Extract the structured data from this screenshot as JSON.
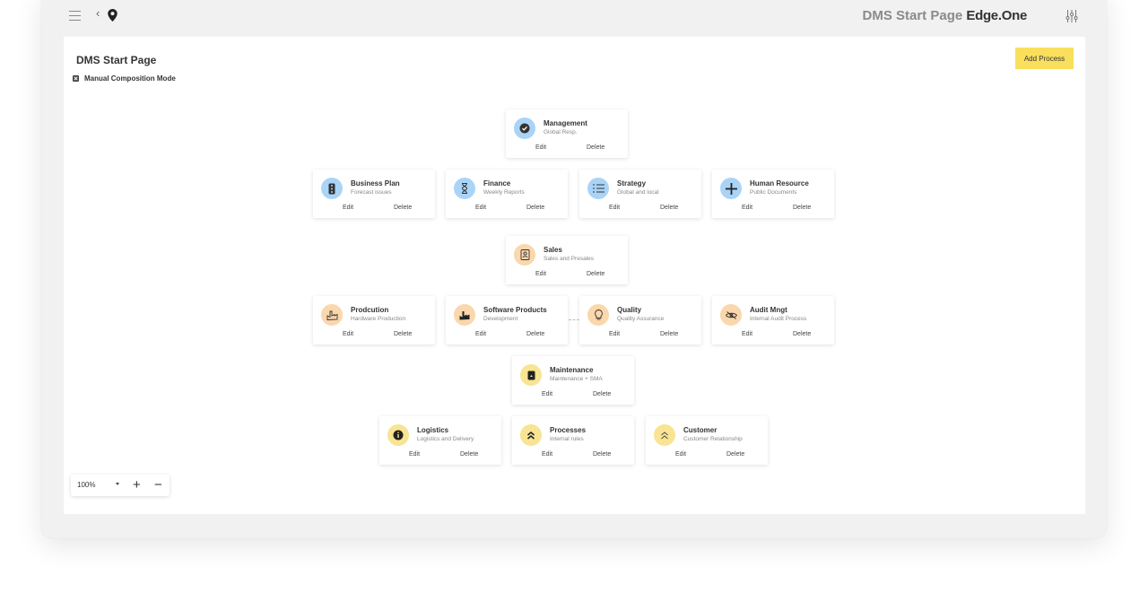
{
  "header": {
    "brand_muted": "DMS Start Page",
    "brand_strong": "Edge.One",
    "back_glyph": "‹"
  },
  "page": {
    "title": "DMS Start Page",
    "add_button": "Add Process",
    "manual_mode_label": "Manual Composition Mode",
    "manual_mode_checked": true
  },
  "actions": {
    "edit": "Edit",
    "delete": "Delete"
  },
  "colors": {
    "blue": "#a9d4f7",
    "orange": "#fad7ac",
    "yellow": "#f8e492",
    "accent": "#f9df5c"
  },
  "cards": [
    {
      "title": "Management",
      "subtitle": "Global Resp.",
      "icon": "check-circle-icon",
      "color": "blue"
    },
    {
      "title": "Business Plan",
      "subtitle": "Forecast issues",
      "icon": "traffic-light-icon",
      "color": "blue"
    },
    {
      "title": "Finance",
      "subtitle": "Weekly Reports",
      "icon": "hourglass-icon",
      "color": "blue"
    },
    {
      "title": "Strategy",
      "subtitle": "Global and local",
      "icon": "list-icon",
      "color": "blue"
    },
    {
      "title": "Human Resource",
      "subtitle": "Public Documents",
      "icon": "plus-icon",
      "color": "blue"
    },
    {
      "title": "Sales",
      "subtitle": "Sales and Presales",
      "icon": "contact-book-icon",
      "color": "orange"
    },
    {
      "title": "Prodcution",
      "subtitle": "Hardware Production",
      "icon": "factory-outline-icon",
      "color": "orange"
    },
    {
      "title": "Software Products",
      "subtitle": "Development",
      "icon": "factory-icon",
      "color": "orange"
    },
    {
      "title": "Quality",
      "subtitle": "Quality Assurance",
      "icon": "lightbulb-icon",
      "color": "orange"
    },
    {
      "title": "Audit Mngt",
      "subtitle": "Internal Audit Process",
      "icon": "eye-off-icon",
      "color": "orange"
    },
    {
      "title": "Maintenance",
      "subtitle": "Maintenance + SMA",
      "icon": "clipboard-icon",
      "color": "yellow"
    },
    {
      "title": "Logistics",
      "subtitle": "Logistics and Delivery",
      "icon": "info-icon",
      "color": "yellow"
    },
    {
      "title": "Processes",
      "subtitle": "Internal rules",
      "icon": "double-chevron-up-icon",
      "color": "yellow"
    },
    {
      "title": "Customer",
      "subtitle": "Customer Relationship",
      "icon": "double-chevron-up-outline-icon",
      "color": "yellow"
    }
  ],
  "zoom": {
    "level": "100%",
    "plus": "+",
    "minus": "−"
  }
}
